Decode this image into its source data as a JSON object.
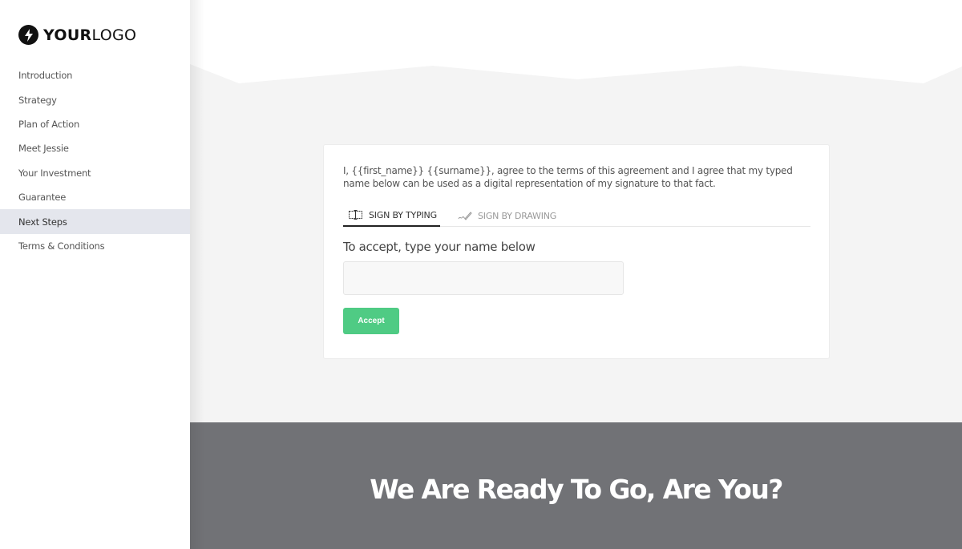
{
  "brand": {
    "logo_bold": "YOUR",
    "logo_light": "LOGO",
    "icon": "lightning-bolt-icon"
  },
  "sidebar": {
    "items": [
      {
        "label": "Introduction",
        "active": false
      },
      {
        "label": "Strategy",
        "active": false
      },
      {
        "label": "Plan of Action",
        "active": false
      },
      {
        "label": "Meet Jessie",
        "active": false
      },
      {
        "label": "Your Investment",
        "active": false
      },
      {
        "label": "Guarantee",
        "active": false
      },
      {
        "label": "Next Steps",
        "active": true
      },
      {
        "label": "Terms & Conditions",
        "active": false
      }
    ]
  },
  "signature": {
    "agreement_text": "I, {{first_name}} {{surname}}, agree to the terms of this agreement and I agree that my typed name below can be used as a digital representation of my signature to that fact.",
    "tabs": [
      {
        "label": "SIGN BY TYPING",
        "icon": "text-cursor-icon",
        "active": true
      },
      {
        "label": "SIGN BY DRAWING",
        "icon": "pen-scribble-icon",
        "active": false
      }
    ],
    "prompt": "To accept, type your name below",
    "input_value": "",
    "input_placeholder": "",
    "accept_label": "Accept"
  },
  "footer": {
    "title": "We Are Ready To Go, Are You?"
  },
  "colors": {
    "accent_green": "#4fcb84",
    "footer_bg": "#717276",
    "active_nav_bg": "#e4e6ed",
    "page_bg": "#f4f4f4"
  }
}
